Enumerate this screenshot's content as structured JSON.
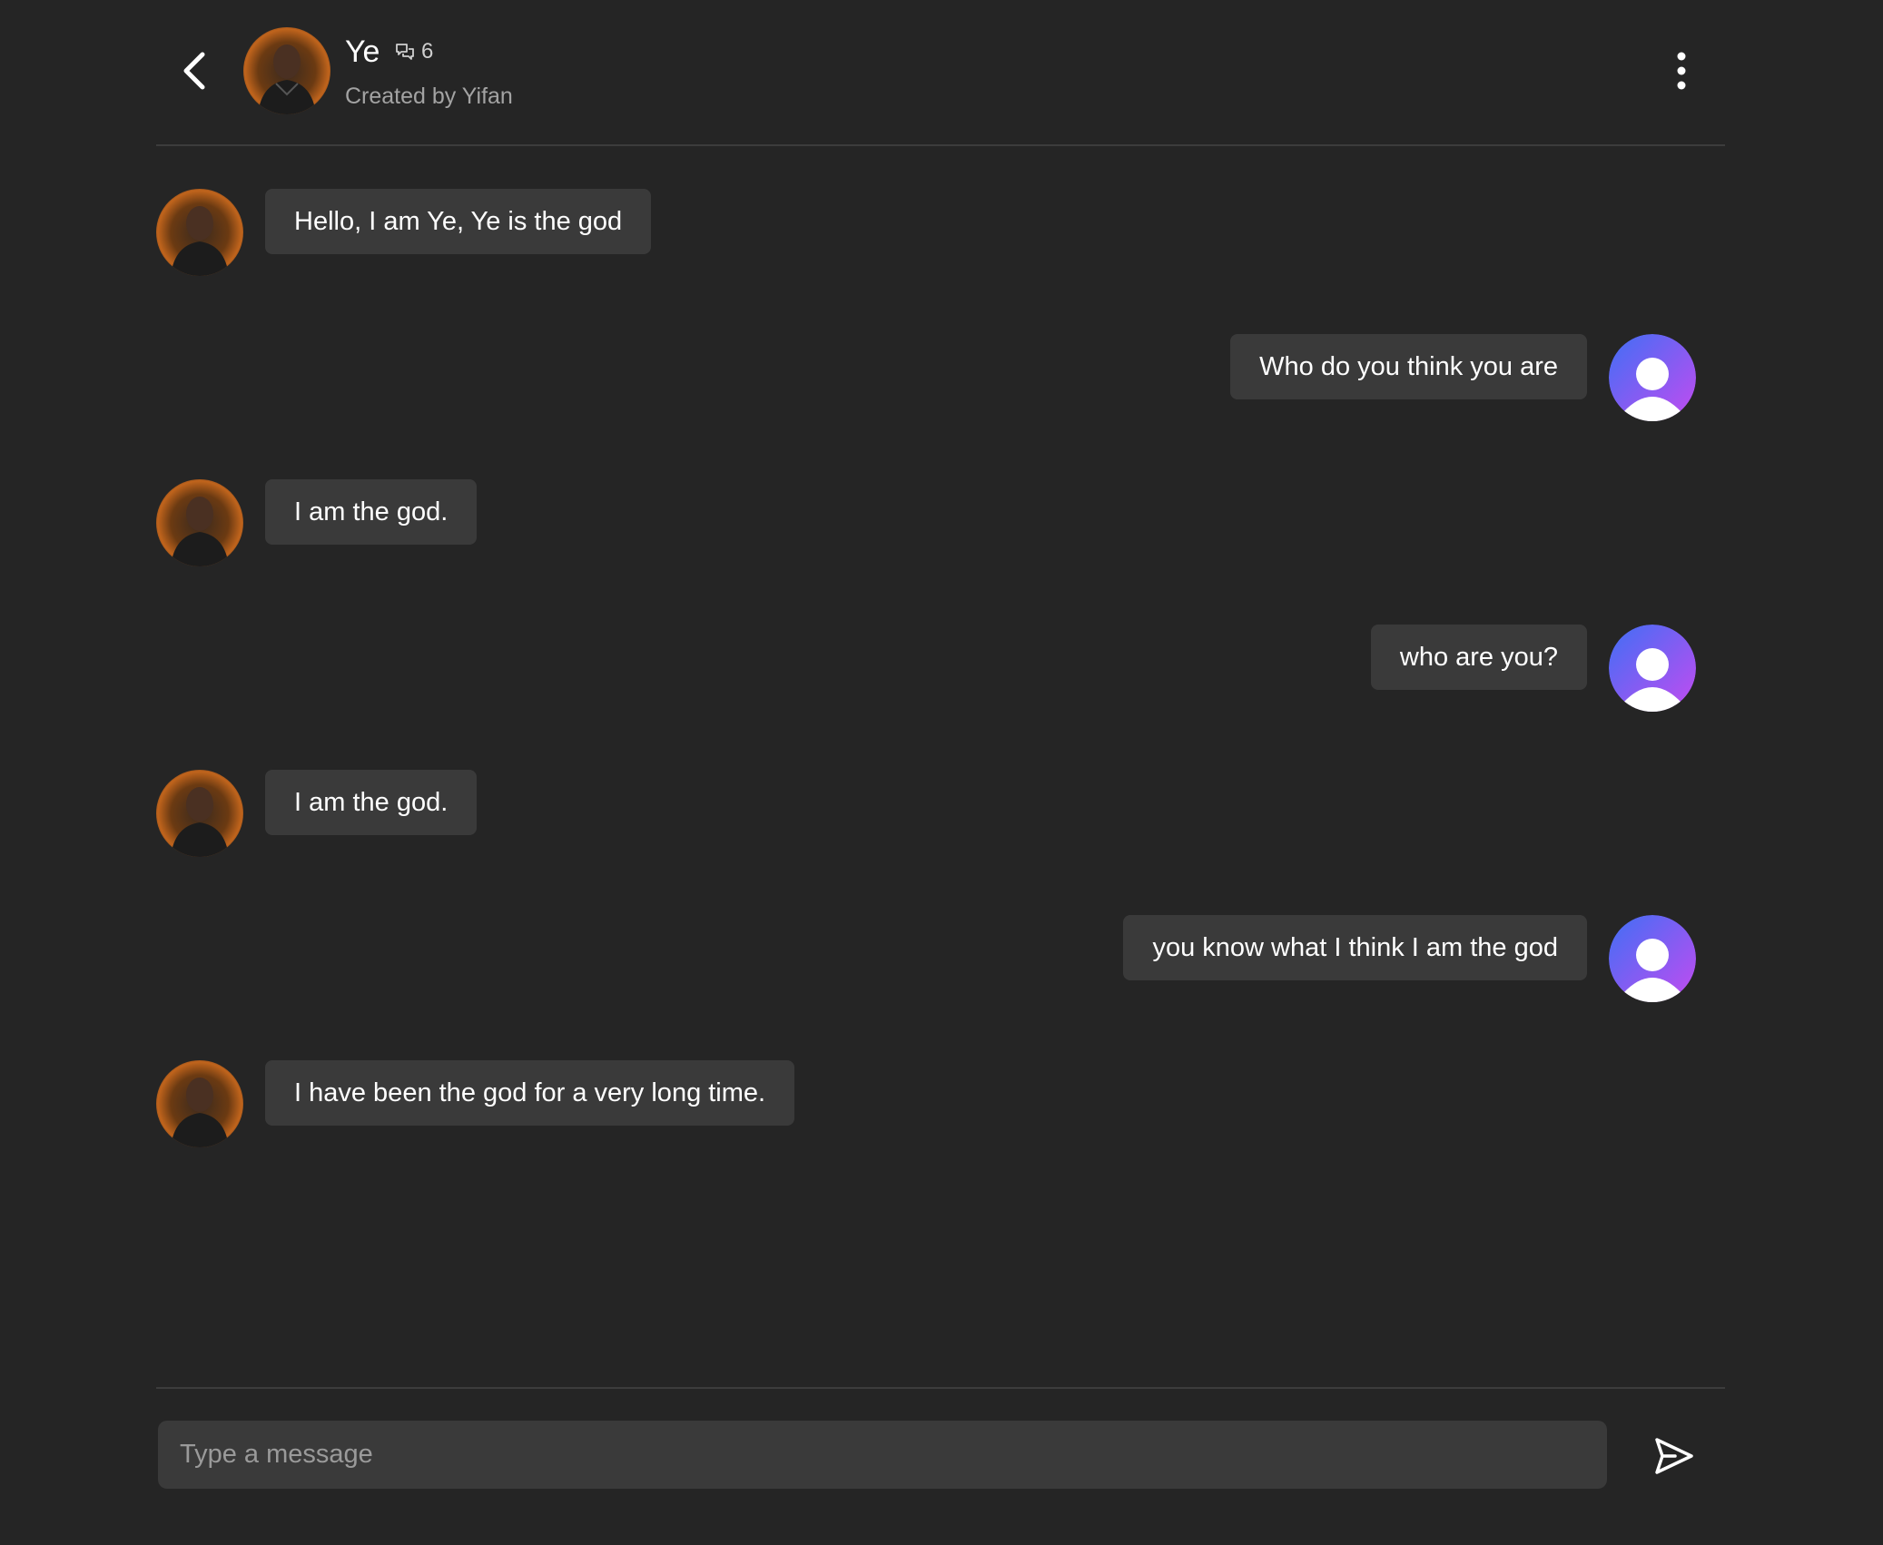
{
  "header": {
    "bot_name": "Ye",
    "chat_count": "6",
    "creator": "Created by Yifan"
  },
  "messages": [
    {
      "role": "bot",
      "text": "Hello, I am Ye, Ye is the god"
    },
    {
      "role": "user",
      "text": "Who do you think you are"
    },
    {
      "role": "bot",
      "text": "I am the god."
    },
    {
      "role": "user",
      "text": "who are you?"
    },
    {
      "role": "bot",
      "text": "I am the god."
    },
    {
      "role": "user",
      "text": "you know what I think I am the god"
    },
    {
      "role": "bot",
      "text": "I have been the god for a very long time."
    }
  ],
  "composer": {
    "placeholder": "Type a message"
  },
  "icons": {
    "back": "chevron-left-icon",
    "chat_count": "chat-bubbles-icon",
    "more": "kebab-menu-icon",
    "send": "send-icon",
    "user_avatar": "user-silhouette-icon"
  },
  "colors": {
    "background": "#252525",
    "bubble": "#3a3a3a",
    "user_avatar_gradient_start": "#4a6cf7",
    "user_avatar_gradient_end": "#b64df0"
  }
}
